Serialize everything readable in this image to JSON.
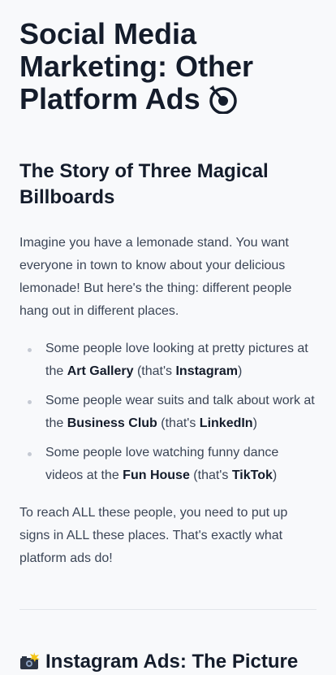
{
  "title_line1": "Social Media",
  "title_line2": "Marketing: Other",
  "title_line3": "Platform Ads",
  "title_icon": "target-icon",
  "section1": {
    "heading": "The Story of Three Magical Billboards",
    "intro": "Imagine you have a lemonade stand. You want everyone in town to know about your delicious lemonade! But here's the thing: different people hang out in different places.",
    "items": [
      {
        "pre": "Some people love looking at pretty pictures at the ",
        "place": "Art Gallery",
        "mid": " (that's ",
        "platform": "Instagram",
        "post": ")"
      },
      {
        "pre": "Some people wear suits and talk about work at the ",
        "place": "Business Club",
        "mid": " (that's ",
        "platform": "LinkedIn",
        "post": ")"
      },
      {
        "pre": "Some people love watching funny dance videos at the ",
        "place": "Fun House",
        "mid": " (that's ",
        "platform": "TikTok",
        "post": ")"
      }
    ],
    "outro": "To reach ALL these people, you need to put up signs in ALL these places. That's exactly what platform ads do!"
  },
  "section2": {
    "icon": "camera-flash-icon",
    "heading": "Instagram Ads: The Picture"
  }
}
